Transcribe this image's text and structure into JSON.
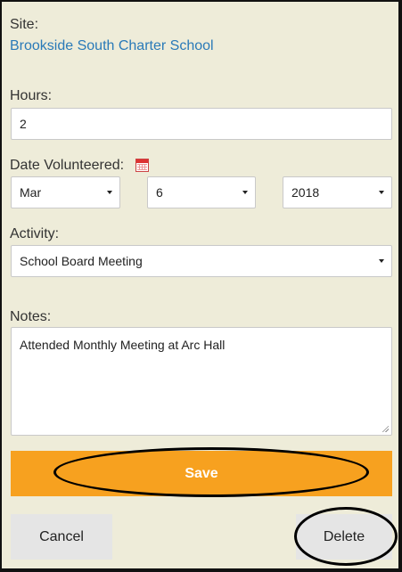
{
  "site": {
    "label": "Site:",
    "name": "Brookside South Charter School"
  },
  "hours": {
    "label": "Hours:",
    "value": "2"
  },
  "date": {
    "label": "Date Volunteered:",
    "month": "Mar",
    "day": "6",
    "year": "2018"
  },
  "activity": {
    "label": "Activity:",
    "value": "School Board Meeting"
  },
  "notes": {
    "label": "Notes:",
    "value": "Attended Monthly Meeting at Arc Hall"
  },
  "buttons": {
    "save": "Save",
    "cancel": "Cancel",
    "delete": "Delete"
  },
  "colors": {
    "background": "#eeecd9",
    "save": "#f7a11f",
    "link": "#2a7ab8",
    "secondary_button": "#e5e5e5"
  },
  "icons": {
    "calendar": "calendar-icon"
  }
}
